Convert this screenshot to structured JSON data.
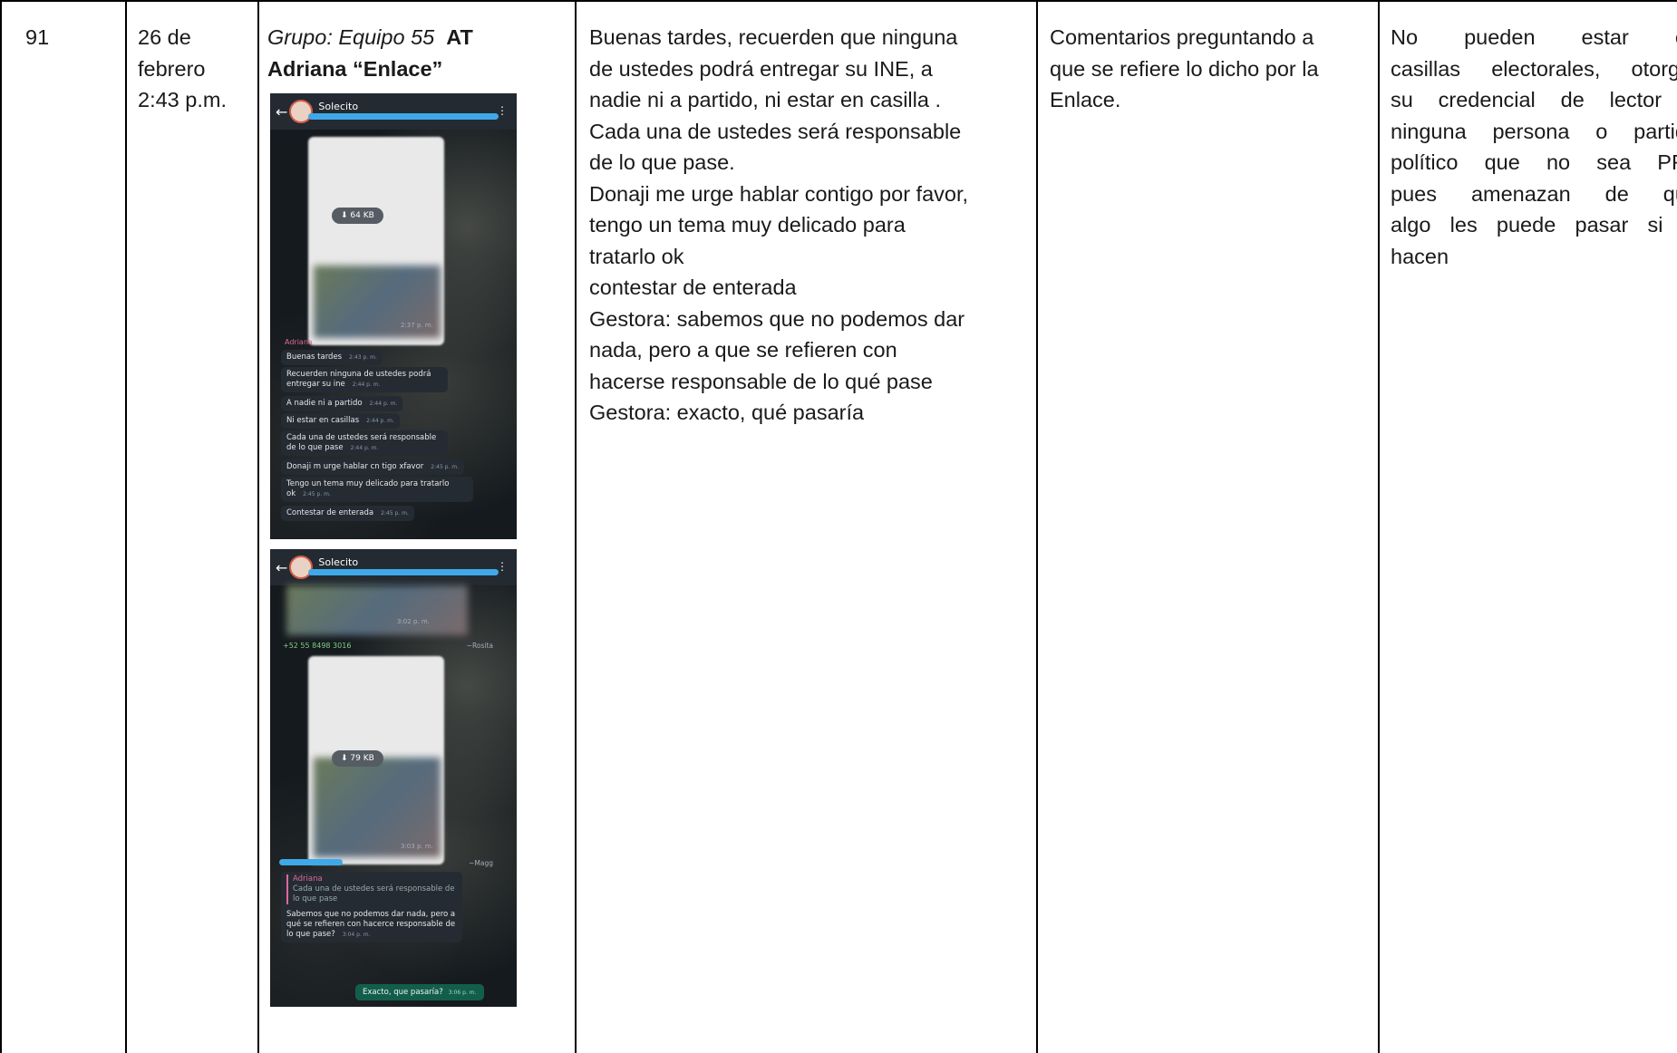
{
  "row": {
    "number": "91",
    "date_line1": "26 de",
    "date_line2": "febrero",
    "date_line3": "2:43 p.m.",
    "group_prefix": "Grupo: Equipo 55",
    "group_at": "AT",
    "group_name": "Adriana “Enlace”",
    "message": [
      "Buenas tardes, recuerden que ninguna",
      "de ustedes podrá entregar su INE, a",
      "nadie ni a partido, ni estar en casilla .",
      "Cada una de ustedes será responsable",
      "de lo que pase.",
      "Donaji me urge hablar contigo por favor,",
      "tengo un tema muy delicado para",
      "tratarlo ok",
      "contestar de enterada",
      "Gestora: sabemos que no podemos  dar",
      "nada, pero a que se refieren con",
      "hacerse responsable  de lo qué pase",
      "Gestora: exacto, qué pasaría"
    ],
    "comments": [
      "Comentarios preguntando a",
      "que se refiere lo dicho por la",
      "Enlace."
    ],
    "analysis": [
      "No pueden estar en",
      "casillas electorales, otorgar",
      "su credencial de lector a",
      "ninguna persona o partido",
      "político que no sea PRI,",
      "pues amenazan de que",
      "algo les puede pasar si lo",
      "hacen"
    ]
  },
  "screenshot1": {
    "contact": "Solecito",
    "download_size": "64 KB",
    "image_time": "2:37 p. m.",
    "sender": "Adriana",
    "messages": [
      {
        "text": "Buenas tardes",
        "time": "2:43 p. m."
      },
      {
        "text": "Recuerden ninguna  de ustedes podrá entregar su ine",
        "time": "2:44 p. m."
      },
      {
        "text": "A nadie ni a partido",
        "time": "2:44 p. m."
      },
      {
        "text": "Ni estar en casillas",
        "time": "2:44 p. m."
      },
      {
        "text": "Cada una de ustedes será responsable de lo que pase",
        "time": "2:44 p. m."
      },
      {
        "text": "Donaji m urge hablar cn tigo xfavor",
        "time": "2:45 p. m."
      },
      {
        "text": "Tengo un tema muy delicado para tratarlo ok",
        "time": "2:45 p. m."
      },
      {
        "text": "Contestar de enterada",
        "time": "2:45 p. m."
      }
    ]
  },
  "screenshot2": {
    "contact": "Solecito",
    "top_time": "3:02 p. m.",
    "phone_number": "+52 55 8498 3016",
    "rosita": "~Rosita",
    "download_size": "79 KB",
    "image_time": "3:03 p. m.",
    "maggie": "~Magg",
    "quoted_sender": "Adriana",
    "quoted_text": "Cada una de ustedes será responsable de lo que pase",
    "reply_text": "Sabemos que no podemos dar nada, pero a qué se refieren con hacerce responsable de lo que pase?",
    "reply_time": "3:04 p. m.",
    "out_text": "Exacto, que pasaría?",
    "out_time": "3:06 p. m."
  },
  "colors": {
    "border": "#000000",
    "scribble": "#3fa8e8",
    "sender_pink": "#e0679a",
    "outgoing_green": "#135e4b"
  }
}
